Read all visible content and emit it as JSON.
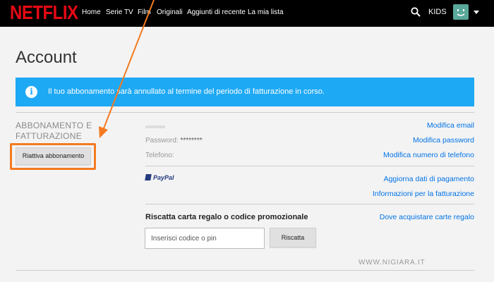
{
  "header": {
    "logo": "NETFLIX",
    "nav": [
      "Home",
      "Serie TV",
      "Film",
      "Originali",
      "Aggiunti di recente",
      "La mia lista"
    ],
    "kids": "KIDS",
    "icons": [
      "search-icon",
      "avatar",
      "chevron-down-icon"
    ]
  },
  "page": {
    "title": "Account"
  },
  "banner": {
    "text": "Il tuo abbonamento sarà annullato al termine del periodo di fatturazione in corso.",
    "icon": "info-icon",
    "color": "#1ea9f5"
  },
  "membership": {
    "title_line1": "ABBONAMENTO E",
    "title_line2": "FATTURAZIONE",
    "reactivate_button": "Riattiva abbonamento",
    "password_label": "Password:",
    "password_value": "********",
    "phone_label": "Telefono:",
    "links": {
      "email": "Modifica email",
      "password": "Modifica password",
      "phone": "Modifica numero di telefono",
      "payment": "Aggiorna dati di pagamento",
      "billing": "Informazioni per la fatturazione",
      "gift_where": "Dove acquistare carte regalo"
    },
    "payment_method": "PayPal"
  },
  "redeem": {
    "title": "Riscatta carta regalo o codice promozionale",
    "placeholder": "Inserisci codice o pin",
    "button": "Riscatta"
  },
  "watermark": "WWW.NIGIARA.IT",
  "highlight_color": "#f47a20"
}
